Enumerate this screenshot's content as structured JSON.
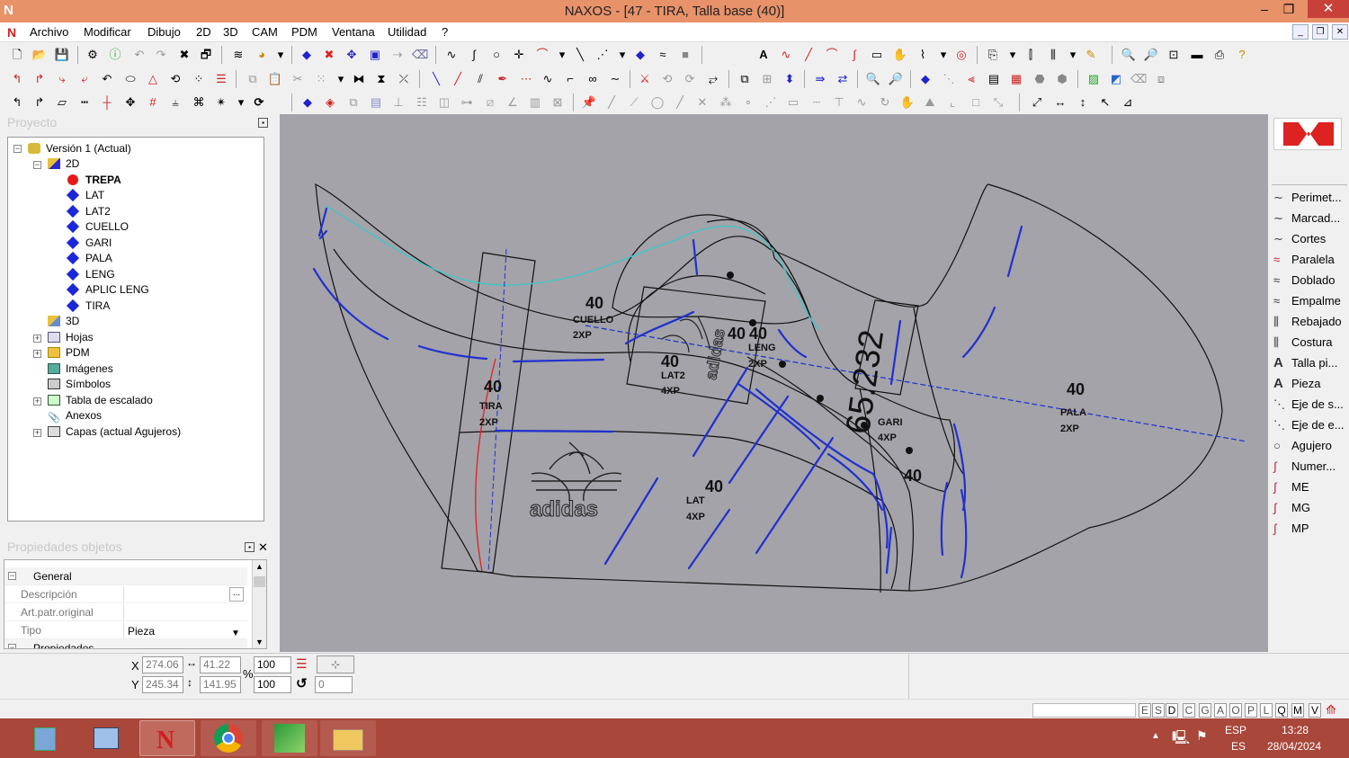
{
  "window": {
    "title": "NAXOS - [47 - TIRA, Talla base (40)]",
    "logo": "N"
  },
  "menu": [
    "Archivo",
    "Modificar",
    "Dibujo",
    "2D",
    "3D",
    "CAM",
    "PDM",
    "Ventana",
    "Utilidad",
    "?"
  ],
  "project_panel": {
    "title": "Proyecto",
    "tree": [
      {
        "label": "Versión 1 (Actual)",
        "level": 0,
        "icon": "version-icon",
        "expanded": true
      },
      {
        "label": "2D",
        "level": 1,
        "icon": "folder-2d-icon",
        "expanded": true
      },
      {
        "label": "TREPA",
        "level": 2,
        "icon": "red-dot-icon",
        "selected": true
      },
      {
        "label": "LAT",
        "level": 2,
        "icon": "blue-diamond-icon"
      },
      {
        "label": "LAT2",
        "level": 2,
        "icon": "blue-diamond-icon"
      },
      {
        "label": "CUELLO",
        "level": 2,
        "icon": "blue-diamond-icon"
      },
      {
        "label": "GARI",
        "level": 2,
        "icon": "blue-diamond-icon"
      },
      {
        "label": "PALA",
        "level": 2,
        "icon": "blue-diamond-icon"
      },
      {
        "label": "LENG",
        "level": 2,
        "icon": "blue-diamond-icon"
      },
      {
        "label": "APLIC LENG",
        "level": 2,
        "icon": "blue-diamond-icon"
      },
      {
        "label": "TIRA",
        "level": 2,
        "icon": "blue-diamond-icon"
      },
      {
        "label": "3D",
        "level": 1,
        "icon": "folder-3d-icon"
      },
      {
        "label": "Hojas",
        "level": 1,
        "icon": "sheets-icon",
        "expandable": true
      },
      {
        "label": "PDM",
        "level": 1,
        "icon": "pdm-folder-icon",
        "expandable": true
      },
      {
        "label": "Imágenes",
        "level": 1,
        "icon": "images-icon"
      },
      {
        "label": "Símbolos",
        "level": 1,
        "icon": "symbols-icon"
      },
      {
        "label": "Tabla de escalado",
        "level": 1,
        "icon": "scale-table-icon",
        "expandable": true
      },
      {
        "label": "Anexos",
        "level": 1,
        "icon": "attachments-icon"
      },
      {
        "label": "Capas (actual Agujeros)",
        "level": 1,
        "icon": "layers-icon",
        "expandable": true
      }
    ]
  },
  "properties_panel": {
    "title": "Propiedades objetos",
    "section_general": "General",
    "rows": [
      {
        "key": "Descripción",
        "value": ""
      },
      {
        "key": "Art.patr.original",
        "value": ""
      },
      {
        "key": "Tipo",
        "value": "Pieza"
      }
    ],
    "section_properties": "Propiedades"
  },
  "canvas": {
    "labels": [
      {
        "text": "40",
        "name": "size-label-cuello"
      },
      {
        "text": "CUELLO",
        "name": "piece-name-cuello"
      },
      {
        "text": "2XP",
        "name": "qty-cuello"
      },
      {
        "text": "40",
        "name": "size-label-lat2"
      },
      {
        "text": "LAT2",
        "name": "piece-name-lat2"
      },
      {
        "text": "4XP",
        "name": "qty-lat2"
      },
      {
        "text": "40",
        "name": "size-label-leng-a"
      },
      {
        "text": "40",
        "name": "size-label-leng-b"
      },
      {
        "text": "LENG",
        "name": "piece-name-leng"
      },
      {
        "text": "2XP",
        "name": "qty-leng"
      },
      {
        "text": "40",
        "name": "size-label-tira"
      },
      {
        "text": "TIRA",
        "name": "piece-name-tira"
      },
      {
        "text": "2XP",
        "name": "qty-tira"
      },
      {
        "text": "40",
        "name": "size-label-lat"
      },
      {
        "text": "LAT",
        "name": "piece-name-lat"
      },
      {
        "text": "4XP",
        "name": "qty-lat"
      },
      {
        "text": "GARI",
        "name": "piece-name-gari"
      },
      {
        "text": "4XP",
        "name": "qty-gari"
      },
      {
        "text": "40",
        "name": "size-label-gari"
      },
      {
        "text": "40",
        "name": "size-label-pala"
      },
      {
        "text": "PALA",
        "name": "piece-name-pala"
      },
      {
        "text": "2XP",
        "name": "qty-pala"
      }
    ],
    "measure": "65.232",
    "brand_text": "adidas"
  },
  "right_tools": [
    {
      "label": "Perimet...",
      "icon": "perimeter-icon"
    },
    {
      "label": "Marcad...",
      "icon": "marker-icon"
    },
    {
      "label": "Cortes",
      "icon": "cuts-icon"
    },
    {
      "label": "Paralela",
      "icon": "parallel-icon"
    },
    {
      "label": "Doblado",
      "icon": "fold-icon"
    },
    {
      "label": "Empalme",
      "icon": "splice-icon"
    },
    {
      "label": "Rebajado",
      "icon": "skive-icon"
    },
    {
      "label": "Costura",
      "icon": "seam-icon"
    },
    {
      "label": "Talla pi...",
      "icon": "size-text-icon"
    },
    {
      "label": "Pieza",
      "icon": "piece-text-icon"
    },
    {
      "label": "Eje de s...",
      "icon": "axis-icon"
    },
    {
      "label": "Eje de e...",
      "icon": "axis-icon"
    },
    {
      "label": "Agujero",
      "icon": "hole-icon"
    },
    {
      "label": "Numer...",
      "icon": "number-icon"
    },
    {
      "label": "ME",
      "icon": "me-icon"
    },
    {
      "label": "MG",
      "icon": "mg-icon"
    },
    {
      "label": "MP",
      "icon": "mp-icon"
    }
  ],
  "status": {
    "x_label": "X",
    "y_label": "Y",
    "x": "274.06",
    "y": "245.34",
    "w": "41.22",
    "h": "141.95",
    "scale_x": "100",
    "scale_y": "100",
    "percent": "%",
    "rotation": "0"
  },
  "layers": [
    "E",
    "S",
    "D",
    "C",
    "G",
    "A",
    "O",
    "P",
    "L",
    "Q",
    "M",
    "V"
  ],
  "tray": {
    "lang1": "ESP",
    "lang2": "ES",
    "time": "13:28",
    "date": "28/04/2024"
  },
  "colors": {
    "titlebar": "#e8926a",
    "taskbar": "#a8473a",
    "canvas": "#a3a3a9",
    "piece_blue": "#1b27d8",
    "trepa_red": "#e81818",
    "cyan": "#3cc8c8"
  }
}
